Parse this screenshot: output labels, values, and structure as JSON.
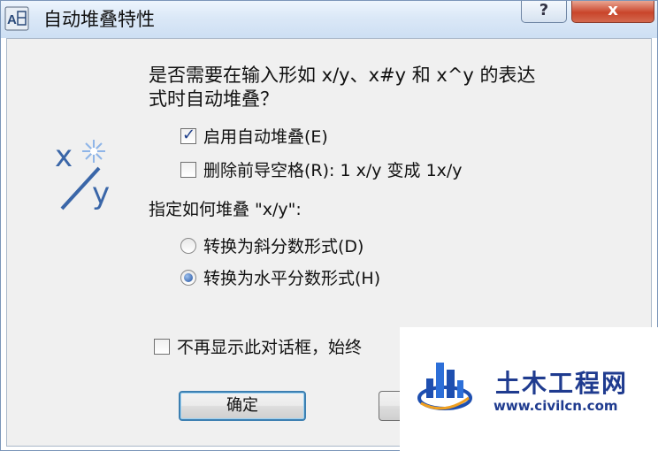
{
  "window": {
    "title": "自动堆叠特性",
    "help_label": "?",
    "close_label": "x"
  },
  "dialog": {
    "question_line1": "是否需要在输入形如 x/y、x#y 和 x^y 的表达",
    "question_line2": "式时自动堆叠？",
    "icon_glyph_x": "x",
    "icon_glyph_y": "y",
    "options": {
      "enable_autostack": {
        "label": "启用自动堆叠(E)",
        "checked": true
      },
      "remove_leading_blank": {
        "label": "删除前导空格(R): 1 x/y 变成 1x/y",
        "checked": false
      }
    },
    "stack_section_label": "指定如何堆叠 \"x/y\":",
    "radios": [
      {
        "label": "转换为斜分数形式(D)",
        "checked": false
      },
      {
        "label": "转换为水平分数形式(H)",
        "checked": true
      }
    ],
    "dont_show_label": "不再显示此对话框，始终",
    "buttons": {
      "ok": "确定"
    }
  },
  "watermark": {
    "brand": "土木工程网",
    "url": "www.civilcn.com"
  }
}
